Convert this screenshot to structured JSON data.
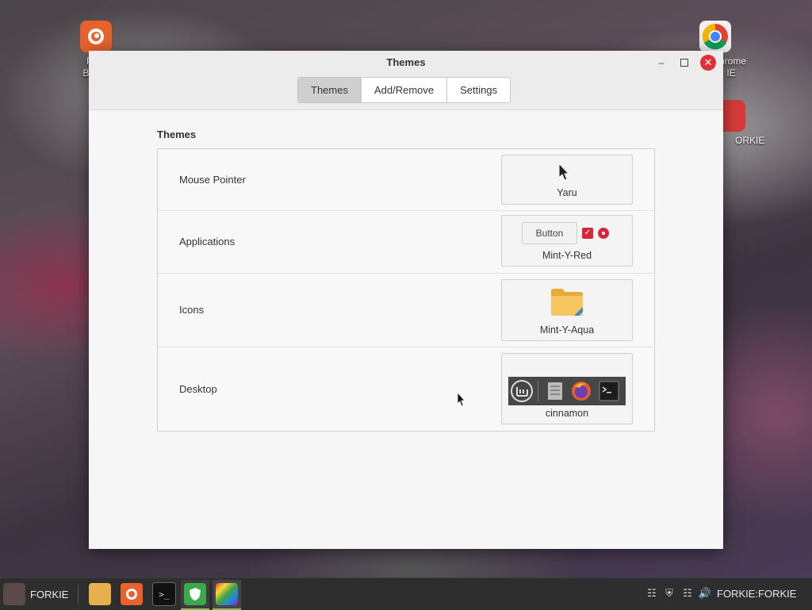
{
  "desktop": {
    "icons": [
      {
        "label_line1": "Firef",
        "label_line2": "Brows"
      },
      {
        "label_line1": "hrome",
        "label_line2": "IE"
      },
      {
        "label_line1": "ORKIE"
      }
    ]
  },
  "window": {
    "title": "Themes",
    "tabs": [
      "Themes",
      "Add/Remove",
      "Settings"
    ],
    "section_title": "Themes",
    "rows": [
      {
        "label": "Mouse Pointer",
        "value": "Yaru"
      },
      {
        "label": "Applications",
        "value": "Mint-Y-Red",
        "preview_button": "Button"
      },
      {
        "label": "Icons",
        "value": "Mint-Y-Aqua"
      },
      {
        "label": "Desktop",
        "value": "cinnamon"
      }
    ]
  },
  "taskbar": {
    "start_label": "FORKIE",
    "user_label": "FORKIE:FORKIE"
  },
  "colors": {
    "accent_red": "#d6273b",
    "close_red": "#e0303a",
    "taskbar_bg": "#2e2e2e"
  }
}
